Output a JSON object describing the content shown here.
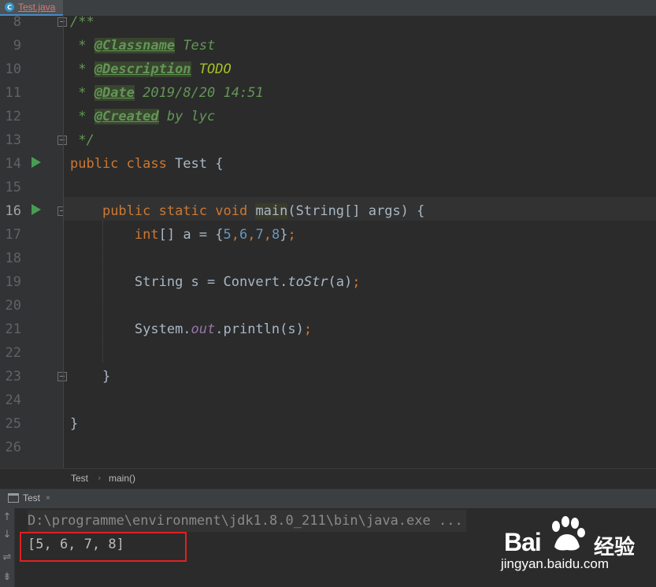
{
  "editor_tab": {
    "label": "Test.java",
    "icon": "C",
    "close": "×"
  },
  "line_numbers": [
    "8",
    "9",
    "10",
    "11",
    "12",
    "13",
    "14",
    "15",
    "16",
    "17",
    "18",
    "19",
    "20",
    "21",
    "22",
    "23",
    "24",
    "25",
    "26"
  ],
  "code": {
    "l8_open": "/**",
    "l9_star": " * ",
    "l9_tag": "@Classname",
    "l9_rest": " Test",
    "l10_star": " * ",
    "l10_tag": "@Description",
    "l10_sp": " ",
    "l10_todo": "TODO",
    "l11_star": " * ",
    "l11_tag": "@Date",
    "l11_rest": " 2019/8/20 14:51",
    "l12_star": " * ",
    "l12_tag": "@Created",
    "l12_rest": " by lyc",
    "l13_close": " */",
    "l14_kw": "public class",
    "l14_rest": " Test {",
    "l16_indent": "    ",
    "l16_kw": "public static void",
    "l16_sp": " ",
    "l16_method": "main",
    "l16_rest": "(String[] args) {",
    "l17_indent": "        ",
    "l17_kw": "int",
    "l17_a": "[] a = {",
    "l17_n1": "5",
    "l17_c1": ",",
    "l17_n2": "6",
    "l17_c2": ",",
    "l17_n3": "7",
    "l17_c3": ",",
    "l17_n4": "8",
    "l17_end": "}",
    "l17_semi": ";",
    "l19_indent": "        ",
    "l19_a": "String s = Convert.",
    "l19_m": "toStr",
    "l19_b": "(a)",
    "l19_semi": ";",
    "l21_indent": "        ",
    "l21_a": "System.",
    "l21_f": "out",
    "l21_b": ".println(s)",
    "l21_semi": ";",
    "l23": "    }",
    "l25": "}"
  },
  "breadcrumb": {
    "class": "Test",
    "method": "main()"
  },
  "run_panel": {
    "tab_label": "Test",
    "close": "×",
    "command": "D:\\programme\\environment\\jdk1.8.0_211\\bin\\java.exe ...",
    "output": "[5, 6, 7, 8]",
    "tools": [
      "↑",
      "↓",
      "⇌",
      "⇟"
    ]
  },
  "watermark": {
    "brand": "Bai",
    "brand2": "经验",
    "url": "jingyan.baidu.com"
  },
  "colors": {
    "keyword": "#cc7832",
    "number": "#6897bb",
    "doc": "#629755",
    "todo": "#a8c023",
    "field": "#9876aa",
    "highlight_box": "#e02020"
  }
}
